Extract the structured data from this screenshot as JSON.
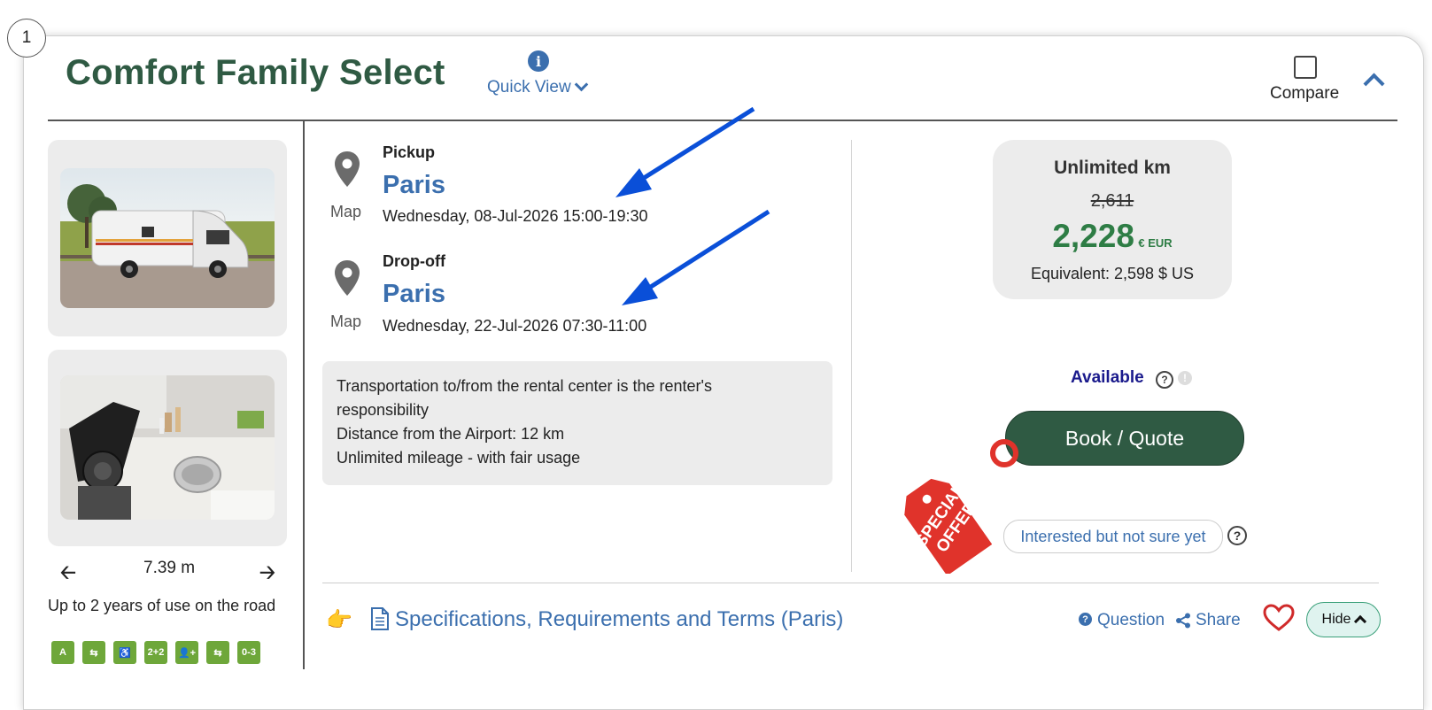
{
  "listing": {
    "index": "1",
    "title": "Comfort Family Select",
    "quick_view": "Quick View",
    "compare_label": "Compare"
  },
  "gallery": {
    "length": "7.39 m",
    "years_note": "Up to 2 years of use on the road",
    "feature_icons": [
      "A",
      "⇆",
      "♿",
      "2+2",
      "👤+",
      "⇆",
      "0-3"
    ]
  },
  "pickup": {
    "heading": "Pickup",
    "city": "Paris",
    "datetime": "Wednesday, 08-Jul-2026 15:00-19:30",
    "map_label": "Map"
  },
  "dropoff": {
    "heading": "Drop-off",
    "city": "Paris",
    "datetime": "Wednesday, 22-Jul-2026 07:30-11:00",
    "map_label": "Map"
  },
  "info": {
    "lines": [
      "Transportation to/from the rental center is the renter's",
      "responsibility",
      "Distance from the Airport: 12 km",
      "Unlimited mileage - with fair usage"
    ]
  },
  "pricing": {
    "label": "Unlimited km",
    "old_price": "2,611",
    "new_price": "2,228",
    "currency": "€ EUR",
    "equivalent": "Equivalent: 2,598 $ US"
  },
  "booking": {
    "availability": "Available",
    "book_label": "Book / Quote",
    "special_offer": "SPECIAL OFFER",
    "interested_label": "Interested but not sure yet"
  },
  "footer": {
    "specs_link": "Specifications, Requirements and Terms (Paris)",
    "question_label": "Question",
    "share_label": "Share",
    "hide_label": "Hide"
  },
  "colors": {
    "brand_green": "#2f5a43",
    "link_blue": "#3b6fae",
    "price_green": "#2e7d45",
    "offer_red": "#e0332b",
    "arrow_blue": "#0a4fd8"
  }
}
